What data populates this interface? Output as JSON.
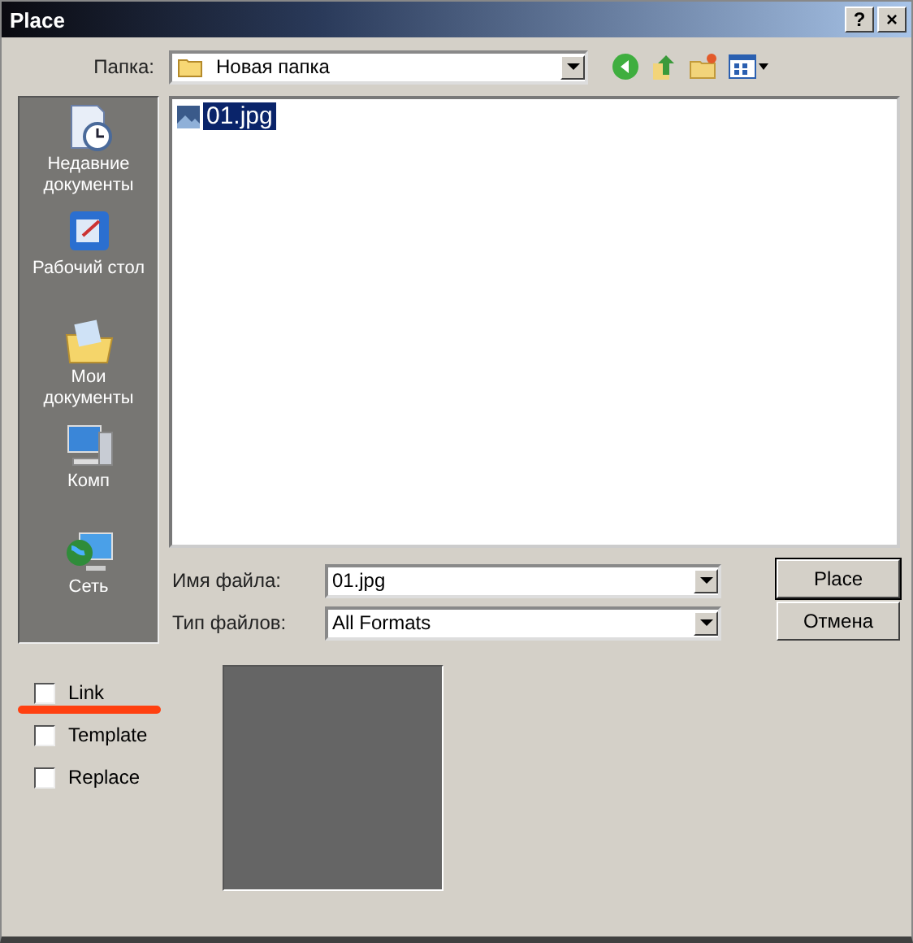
{
  "window": {
    "title": "Place",
    "help_button": "?",
    "close_button": "×"
  },
  "look_in": {
    "label": "Папка:",
    "value": "Новая папка"
  },
  "places": [
    {
      "label": "Недавние документы",
      "kind": "recent"
    },
    {
      "label": "Рабочий стол",
      "kind": "desktop"
    },
    {
      "label": "Мои документы",
      "kind": "documents"
    },
    {
      "label": "Комп",
      "kind": "computer"
    },
    {
      "label": "Сеть",
      "kind": "network"
    }
  ],
  "files": [
    {
      "name": "01.jpg",
      "selected": true
    }
  ],
  "file_name": {
    "label": "Имя файла:",
    "value": "01.jpg"
  },
  "file_type": {
    "label": "Тип файлов:",
    "value": "All Formats"
  },
  "buttons": [
    "Place",
    "Отмена"
  ],
  "options": [
    {
      "label": "Link",
      "checked": false,
      "underlined": true
    },
    {
      "label": "Template",
      "checked": false,
      "underlined": false
    },
    {
      "label": "Replace",
      "checked": false,
      "underlined": false
    }
  ]
}
